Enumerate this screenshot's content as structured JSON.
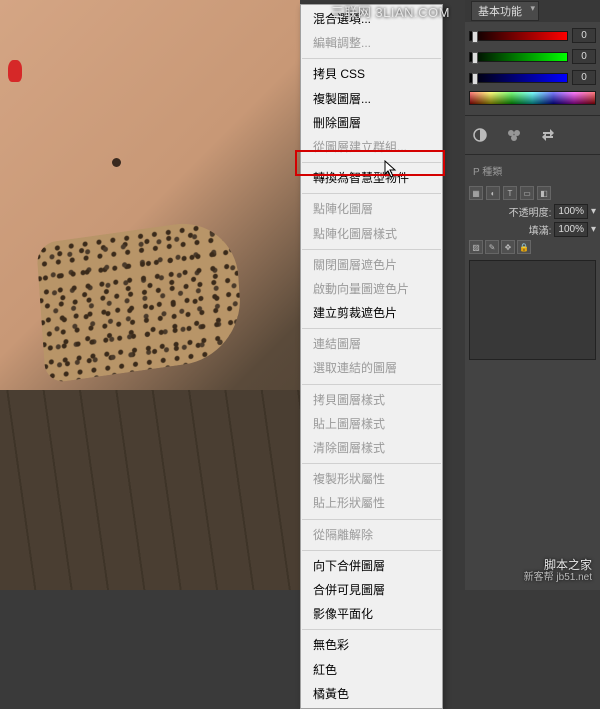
{
  "watermarks": {
    "top": "三联网 3LIAN.COM",
    "bottom_main": "脚本之家",
    "bottom_sub": "jb51.net",
    "bottom_prefix": "新客帮"
  },
  "toolbar": {
    "workspace_label": "基本功能"
  },
  "color_panel": {
    "r": "0",
    "g": "0",
    "b": "0"
  },
  "layers": {
    "tab_kind": "P 種類",
    "opacity_label": "不透明度:",
    "opacity_value": "100%",
    "fill_label": "填滿:",
    "fill_value": "100%"
  },
  "menu": {
    "items": [
      {
        "label": "混合選項...",
        "disabled": false
      },
      {
        "label": "編輯調整...",
        "disabled": true
      },
      {
        "sep": true
      },
      {
        "label": "拷貝 CSS",
        "disabled": false
      },
      {
        "label": "複製圖層...",
        "disabled": false
      },
      {
        "label": "刪除圖層",
        "disabled": false
      },
      {
        "label": "從圖層建立群組...",
        "disabled": true
      },
      {
        "sep": true
      },
      {
        "label": "轉換為智慧型物件",
        "disabled": false
      },
      {
        "sep": true
      },
      {
        "label": "點陣化圖層",
        "disabled": true
      },
      {
        "label": "點陣化圖層樣式",
        "disabled": true
      },
      {
        "sep": true
      },
      {
        "label": "關閉圖層遮色片",
        "disabled": true
      },
      {
        "label": "啟動向量圖遮色片",
        "disabled": true
      },
      {
        "label": "建立剪裁遮色片",
        "disabled": false
      },
      {
        "sep": true
      },
      {
        "label": "連結圖層",
        "disabled": true
      },
      {
        "label": "選取連結的圖層",
        "disabled": true
      },
      {
        "sep": true
      },
      {
        "label": "拷貝圖層樣式",
        "disabled": true
      },
      {
        "label": "貼上圖層樣式",
        "disabled": true
      },
      {
        "label": "清除圖層樣式",
        "disabled": true
      },
      {
        "sep": true
      },
      {
        "label": "複製形狀屬性",
        "disabled": true
      },
      {
        "label": "貼上形狀屬性",
        "disabled": true
      },
      {
        "sep": true
      },
      {
        "label": "從隔離解除",
        "disabled": true
      },
      {
        "sep": true
      },
      {
        "label": "向下合併圖層",
        "disabled": false
      },
      {
        "label": "合併可見圖層",
        "disabled": false
      },
      {
        "label": "影像平面化",
        "disabled": false
      },
      {
        "sep": true
      },
      {
        "label": "無色彩",
        "disabled": false
      },
      {
        "label": "紅色",
        "disabled": false
      },
      {
        "label": "橘黃色",
        "disabled": false
      }
    ]
  }
}
